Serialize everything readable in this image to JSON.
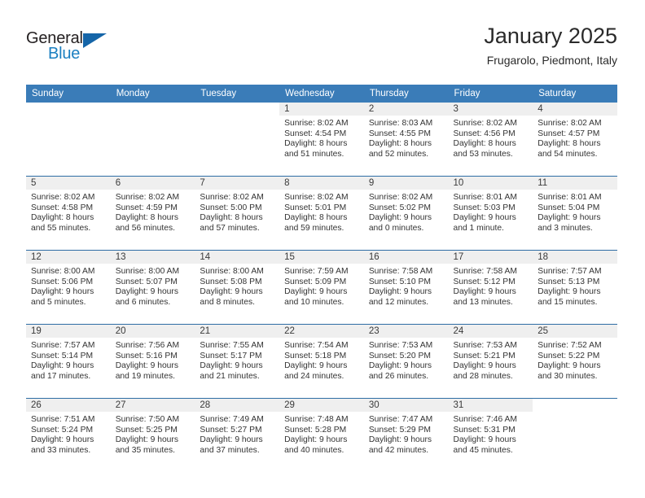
{
  "logo": {
    "word_one": "General",
    "word_two": "Blue",
    "triangle_icon": "triangle-icon",
    "accent_dark": "#1565a8",
    "accent_light": "#1a7fc1"
  },
  "header": {
    "title": "January 2025",
    "subtitle": "Frugarolo, Piedmont, Italy"
  },
  "theme": {
    "header_bg": "#3a7cb8",
    "row_divider": "#2e6da4",
    "daynum_band_bg": "#efefef",
    "text": "#333333"
  },
  "columns": [
    "Sunday",
    "Monday",
    "Tuesday",
    "Wednesday",
    "Thursday",
    "Friday",
    "Saturday"
  ],
  "labels": {
    "sunrise": "Sunrise:",
    "sunset": "Sunset:",
    "daylight": "Daylight:"
  },
  "weeks": [
    [
      {
        "day": "",
        "blank": true
      },
      {
        "day": "",
        "blank": true
      },
      {
        "day": "",
        "blank": true
      },
      {
        "day": "1",
        "sunrise": "Sunrise: 8:02 AM",
        "sunset": "Sunset: 4:54 PM",
        "daylight_1": "Daylight: 8 hours",
        "daylight_2": "and 51 minutes."
      },
      {
        "day": "2",
        "sunrise": "Sunrise: 8:03 AM",
        "sunset": "Sunset: 4:55 PM",
        "daylight_1": "Daylight: 8 hours",
        "daylight_2": "and 52 minutes."
      },
      {
        "day": "3",
        "sunrise": "Sunrise: 8:02 AM",
        "sunset": "Sunset: 4:56 PM",
        "daylight_1": "Daylight: 8 hours",
        "daylight_2": "and 53 minutes."
      },
      {
        "day": "4",
        "sunrise": "Sunrise: 8:02 AM",
        "sunset": "Sunset: 4:57 PM",
        "daylight_1": "Daylight: 8 hours",
        "daylight_2": "and 54 minutes."
      }
    ],
    [
      {
        "day": "5",
        "sunrise": "Sunrise: 8:02 AM",
        "sunset": "Sunset: 4:58 PM",
        "daylight_1": "Daylight: 8 hours",
        "daylight_2": "and 55 minutes."
      },
      {
        "day": "6",
        "sunrise": "Sunrise: 8:02 AM",
        "sunset": "Sunset: 4:59 PM",
        "daylight_1": "Daylight: 8 hours",
        "daylight_2": "and 56 minutes."
      },
      {
        "day": "7",
        "sunrise": "Sunrise: 8:02 AM",
        "sunset": "Sunset: 5:00 PM",
        "daylight_1": "Daylight: 8 hours",
        "daylight_2": "and 57 minutes."
      },
      {
        "day": "8",
        "sunrise": "Sunrise: 8:02 AM",
        "sunset": "Sunset: 5:01 PM",
        "daylight_1": "Daylight: 8 hours",
        "daylight_2": "and 59 minutes."
      },
      {
        "day": "9",
        "sunrise": "Sunrise: 8:02 AM",
        "sunset": "Sunset: 5:02 PM",
        "daylight_1": "Daylight: 9 hours",
        "daylight_2": "and 0 minutes."
      },
      {
        "day": "10",
        "sunrise": "Sunrise: 8:01 AM",
        "sunset": "Sunset: 5:03 PM",
        "daylight_1": "Daylight: 9 hours",
        "daylight_2": "and 1 minute."
      },
      {
        "day": "11",
        "sunrise": "Sunrise: 8:01 AM",
        "sunset": "Sunset: 5:04 PM",
        "daylight_1": "Daylight: 9 hours",
        "daylight_2": "and 3 minutes."
      }
    ],
    [
      {
        "day": "12",
        "sunrise": "Sunrise: 8:00 AM",
        "sunset": "Sunset: 5:06 PM",
        "daylight_1": "Daylight: 9 hours",
        "daylight_2": "and 5 minutes."
      },
      {
        "day": "13",
        "sunrise": "Sunrise: 8:00 AM",
        "sunset": "Sunset: 5:07 PM",
        "daylight_1": "Daylight: 9 hours",
        "daylight_2": "and 6 minutes."
      },
      {
        "day": "14",
        "sunrise": "Sunrise: 8:00 AM",
        "sunset": "Sunset: 5:08 PM",
        "daylight_1": "Daylight: 9 hours",
        "daylight_2": "and 8 minutes."
      },
      {
        "day": "15",
        "sunrise": "Sunrise: 7:59 AM",
        "sunset": "Sunset: 5:09 PM",
        "daylight_1": "Daylight: 9 hours",
        "daylight_2": "and 10 minutes."
      },
      {
        "day": "16",
        "sunrise": "Sunrise: 7:58 AM",
        "sunset": "Sunset: 5:10 PM",
        "daylight_1": "Daylight: 9 hours",
        "daylight_2": "and 12 minutes."
      },
      {
        "day": "17",
        "sunrise": "Sunrise: 7:58 AM",
        "sunset": "Sunset: 5:12 PM",
        "daylight_1": "Daylight: 9 hours",
        "daylight_2": "and 13 minutes."
      },
      {
        "day": "18",
        "sunrise": "Sunrise: 7:57 AM",
        "sunset": "Sunset: 5:13 PM",
        "daylight_1": "Daylight: 9 hours",
        "daylight_2": "and 15 minutes."
      }
    ],
    [
      {
        "day": "19",
        "sunrise": "Sunrise: 7:57 AM",
        "sunset": "Sunset: 5:14 PM",
        "daylight_1": "Daylight: 9 hours",
        "daylight_2": "and 17 minutes."
      },
      {
        "day": "20",
        "sunrise": "Sunrise: 7:56 AM",
        "sunset": "Sunset: 5:16 PM",
        "daylight_1": "Daylight: 9 hours",
        "daylight_2": "and 19 minutes."
      },
      {
        "day": "21",
        "sunrise": "Sunrise: 7:55 AM",
        "sunset": "Sunset: 5:17 PM",
        "daylight_1": "Daylight: 9 hours",
        "daylight_2": "and 21 minutes."
      },
      {
        "day": "22",
        "sunrise": "Sunrise: 7:54 AM",
        "sunset": "Sunset: 5:18 PM",
        "daylight_1": "Daylight: 9 hours",
        "daylight_2": "and 24 minutes."
      },
      {
        "day": "23",
        "sunrise": "Sunrise: 7:53 AM",
        "sunset": "Sunset: 5:20 PM",
        "daylight_1": "Daylight: 9 hours",
        "daylight_2": "and 26 minutes."
      },
      {
        "day": "24",
        "sunrise": "Sunrise: 7:53 AM",
        "sunset": "Sunset: 5:21 PM",
        "daylight_1": "Daylight: 9 hours",
        "daylight_2": "and 28 minutes."
      },
      {
        "day": "25",
        "sunrise": "Sunrise: 7:52 AM",
        "sunset": "Sunset: 5:22 PM",
        "daylight_1": "Daylight: 9 hours",
        "daylight_2": "and 30 minutes."
      }
    ],
    [
      {
        "day": "26",
        "sunrise": "Sunrise: 7:51 AM",
        "sunset": "Sunset: 5:24 PM",
        "daylight_1": "Daylight: 9 hours",
        "daylight_2": "and 33 minutes."
      },
      {
        "day": "27",
        "sunrise": "Sunrise: 7:50 AM",
        "sunset": "Sunset: 5:25 PM",
        "daylight_1": "Daylight: 9 hours",
        "daylight_2": "and 35 minutes."
      },
      {
        "day": "28",
        "sunrise": "Sunrise: 7:49 AM",
        "sunset": "Sunset: 5:27 PM",
        "daylight_1": "Daylight: 9 hours",
        "daylight_2": "and 37 minutes."
      },
      {
        "day": "29",
        "sunrise": "Sunrise: 7:48 AM",
        "sunset": "Sunset: 5:28 PM",
        "daylight_1": "Daylight: 9 hours",
        "daylight_2": "and 40 minutes."
      },
      {
        "day": "30",
        "sunrise": "Sunrise: 7:47 AM",
        "sunset": "Sunset: 5:29 PM",
        "daylight_1": "Daylight: 9 hours",
        "daylight_2": "and 42 minutes."
      },
      {
        "day": "31",
        "sunrise": "Sunrise: 7:46 AM",
        "sunset": "Sunset: 5:31 PM",
        "daylight_1": "Daylight: 9 hours",
        "daylight_2": "and 45 minutes."
      },
      {
        "day": "",
        "blank": true
      }
    ]
  ]
}
